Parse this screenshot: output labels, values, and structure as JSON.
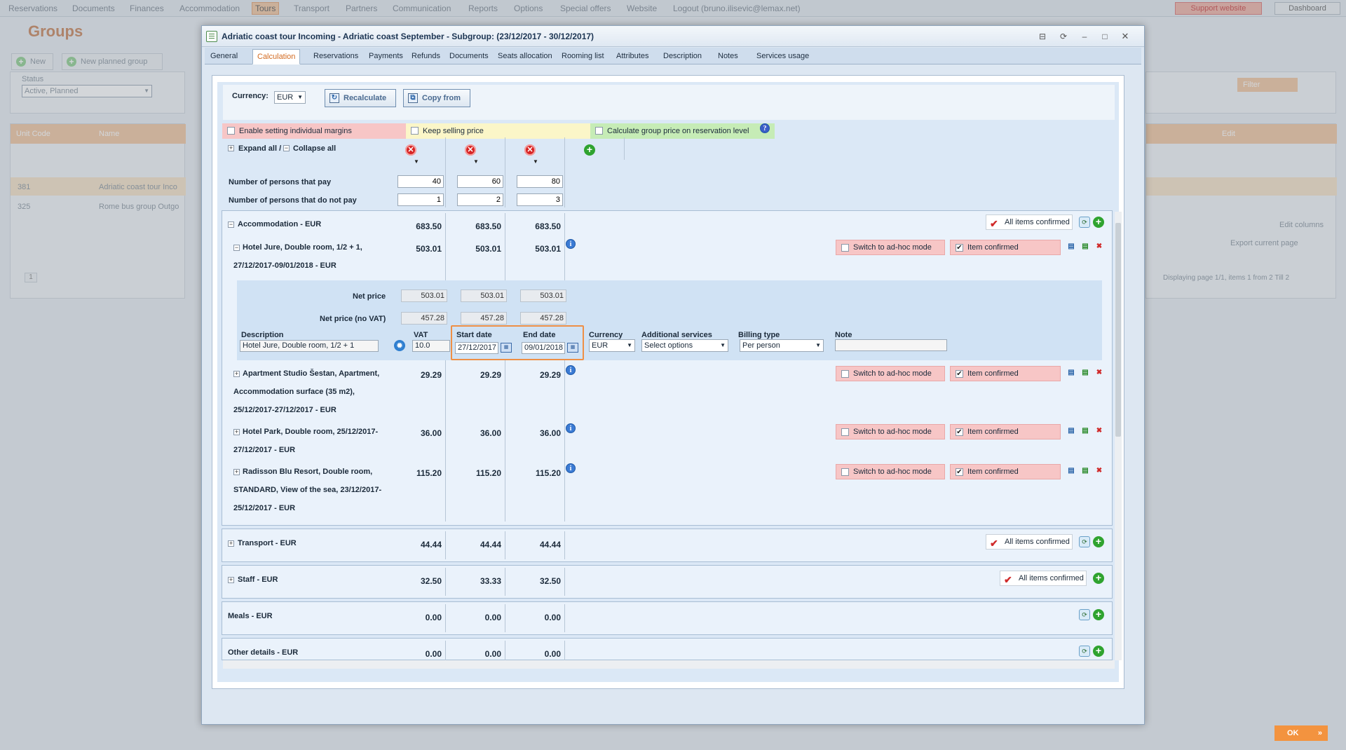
{
  "background": {
    "nav": [
      "Reservations",
      "Documents",
      "Finances",
      "Accommodation",
      "Tours",
      "Transport",
      "Partners",
      "Communication",
      "Reports",
      "Options",
      "Special offers",
      "Website",
      "Logout (bruno.ilisevic@lemax.net)"
    ],
    "support": "Support website",
    "dashboard": "Dashboard",
    "title": "Groups",
    "new_btn": "New",
    "new_planned_btn": "New planned group",
    "status_label": "Status",
    "status_value": "Active, Planned",
    "filter_btn": "Filter",
    "col_unit": "Unit Code",
    "col_name": "Name",
    "col_edit": "Edit",
    "rows": [
      {
        "code": "381",
        "name": "Adriatic coast tour Inco"
      },
      {
        "code": "325",
        "name": "Rome bus group Outgo"
      }
    ],
    "edit_columns": "Edit columns",
    "export": "Export current page",
    "paging": "Displaying page   1/1,  items   1  from   2  Till   2",
    "page_num": "1"
  },
  "modal": {
    "title": "Adriatic coast tour Incoming - Adriatic coast September - Subgroup: (23/12/2017 - 30/12/2017)",
    "tabs": [
      "General",
      "Calculation",
      "Reservations",
      "Payments",
      "Refunds",
      "Documents",
      "Seats allocation",
      "Rooming list",
      "Attributes",
      "Description",
      "Notes",
      "Services usage"
    ],
    "active_tab": "Calculation",
    "currency_label": "Currency:",
    "currency_value": "EUR",
    "recalculate": "Recalculate",
    "copy_from": "Copy from",
    "opt_margins": "Enable setting individual margins",
    "opt_keep": "Keep selling price",
    "opt_group": "Calculate group price on reservation level",
    "expand_all": "Expand all /",
    "collapse_all": "Collapse all",
    "persons_pay_label": "Number of persons that pay",
    "persons_pay": [
      "40",
      "60",
      "80"
    ],
    "persons_nopay_label": "Number of persons that do not pay",
    "persons_nopay": [
      "1",
      "2",
      "3"
    ],
    "all_confirmed": "All items confirmed",
    "switch_adhoc": "Switch to ad-hoc mode",
    "item_confirmed": "Item confirmed",
    "accommodation": {
      "label": "Accommodation - EUR",
      "totals": [
        "683.50",
        "683.50",
        "683.50"
      ],
      "items": [
        {
          "lines": [
            "Hotel Jure, Double room, 1/2 + 1,",
            "27/12/2017-09/01/2018 - EUR"
          ],
          "values": [
            "503.01",
            "503.01",
            "503.01"
          ]
        },
        {
          "lines": [
            "Apartment Studio Šestan, Apartment,",
            "Accommodation surface (35 m2),",
            "25/12/2017-27/12/2017 - EUR"
          ],
          "values": [
            "29.29",
            "29.29",
            "29.29"
          ]
        },
        {
          "lines": [
            "Hotel Park, Double room, 25/12/2017-",
            "27/12/2017 - EUR"
          ],
          "values": [
            "36.00",
            "36.00",
            "36.00"
          ]
        },
        {
          "lines": [
            "Radisson Blu Resort, Double room,",
            "STANDARD, View of the sea, 23/12/2017-",
            "25/12/2017 - EUR"
          ],
          "values": [
            "115.20",
            "115.20",
            "115.20"
          ]
        }
      ]
    },
    "detail": {
      "net_price_label": "Net price",
      "net_price": [
        "503.01",
        "503.01",
        "503.01"
      ],
      "net_novat_label": "Net price (no VAT)",
      "net_novat": [
        "457.28",
        "457.28",
        "457.28"
      ],
      "desc_label": "Description",
      "desc_value": "Hotel Jure, Double room, 1/2 + 1",
      "vat_label": "VAT",
      "vat_value": "10.0",
      "start_label": "Start date",
      "start_value": "27/12/2017",
      "end_label": "End date",
      "end_value": "09/01/2018",
      "currency_label": "Currency",
      "currency_value": "EUR",
      "addl_label": "Additional services",
      "addl_value": "Select options",
      "billing_label": "Billing type",
      "billing_value": "Per person",
      "note_label": "Note"
    },
    "transport": {
      "label": "Transport - EUR",
      "totals": [
        "44.44",
        "44.44",
        "44.44"
      ]
    },
    "staff": {
      "label": "Staff - EUR",
      "totals": [
        "32.50",
        "33.33",
        "32.50"
      ]
    },
    "meals": {
      "label": "Meals - EUR",
      "totals": [
        "0.00",
        "0.00",
        "0.00"
      ]
    },
    "other": {
      "label": "Other details - EUR",
      "totals": [
        "0.00",
        "0.00",
        "0.00"
      ]
    },
    "ok": "OK"
  },
  "colors": {
    "accent": "#f3933f",
    "tab_active": "#d26a20",
    "pink": "#f7c6c6",
    "yellow": "#fbf6c8",
    "green": "#c6ecb6"
  }
}
